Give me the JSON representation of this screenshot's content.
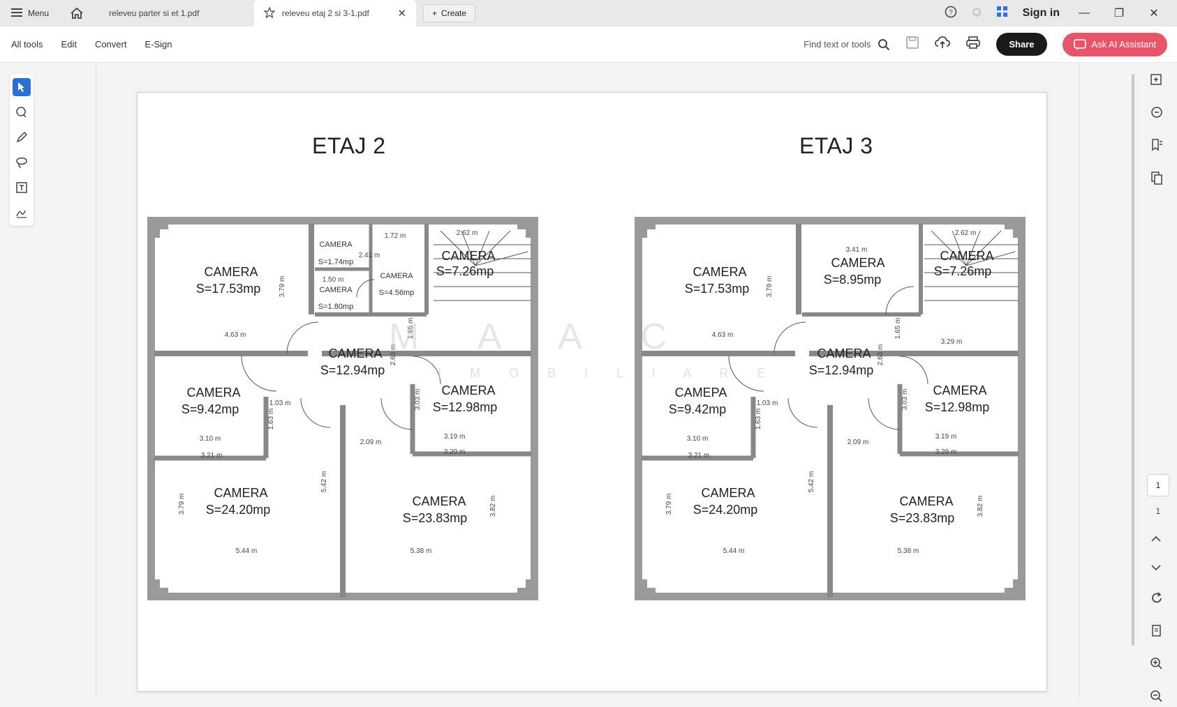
{
  "titlebar": {
    "menu_label": "Menu",
    "tab_inactive": "releveu parter si et 1.pdf",
    "tab_active": "releveu etaj 2 si 3-1.pdf",
    "create_label": "Create",
    "signin_label": "Sign in"
  },
  "toolbar": {
    "menu_items": [
      "All tools",
      "Edit",
      "Convert",
      "E-Sign"
    ],
    "find_placeholder": "Find text or tools",
    "share_label": "Share",
    "ai_label": "Ask AI Assistant"
  },
  "rightrail": {
    "page_current": "1",
    "page_total": "1"
  },
  "document": {
    "etaj2": {
      "title": "ETAJ 2",
      "rooms": [
        {
          "name": "CAMERA",
          "area": "S=17.53mp"
        },
        {
          "name": "CAMERA",
          "area": "S=1.74mp"
        },
        {
          "name": "CAMERA",
          "area": "S=1.80mp"
        },
        {
          "name": "CAMERA",
          "area": "S=4.56mp"
        },
        {
          "name": "CAMERA",
          "area": "S=7.26mp"
        },
        {
          "name": "CAMERA",
          "area": "S=12.94mp"
        },
        {
          "name": "CAMERA",
          "area": "S=9.42mp"
        },
        {
          "name": "CAMERA",
          "area": "S=12.98mp"
        },
        {
          "name": "CAMERA",
          "area": "S=24.20mp"
        },
        {
          "name": "CAMERA",
          "area": "S=23.83mp"
        }
      ],
      "dims": [
        "1.72 m",
        "2.41 m",
        "1.50 m",
        "2.62 m",
        "4.63 m",
        "3.10 m",
        "3.21 m",
        "2.09 m",
        "3.19 m",
        "3.20 m",
        "5.44 m",
        "5.38 m",
        "1.03 m",
        "3.79 m",
        "5.42 m",
        "3.82 m",
        "2.63 m",
        "1.65 m",
        "3.03 m",
        "1.63 m",
        "3.79 m"
      ]
    },
    "etaj3": {
      "title": "ETAJ 3",
      "rooms": [
        {
          "name": "CAMERA",
          "area": "S=17.53mp"
        },
        {
          "name": "CAMERA",
          "area": "S=8.95mp"
        },
        {
          "name": "CAMERA",
          "area": "S=7.26mp"
        },
        {
          "name": "CAMERA",
          "area": "S=12.94mp"
        },
        {
          "name": "CAMEPA",
          "area": "S=9.42mp"
        },
        {
          "name": "CAMERA",
          "area": "S=12.98mp"
        },
        {
          "name": "CAMERA",
          "area": "S=24.20mp"
        },
        {
          "name": "CAMERA",
          "area": "S=23.83mp"
        }
      ],
      "dims": [
        "3.41 m",
        "2.62 m",
        "4.63 m",
        "3.29 m",
        "3.10 m",
        "3.21 m",
        "2.09 m",
        "3.19 m",
        "3.29 m",
        "5.44 m",
        "5.38 m",
        "1.03 m",
        "3.79 m",
        "5.42 m",
        "3.82 m",
        "2.63 m",
        "1.65 m",
        "3.03 m",
        "1.63 m",
        "3.79 m"
      ]
    },
    "watermark": "M A A C",
    "watermark_sub": "I M O B I L I A R E"
  }
}
